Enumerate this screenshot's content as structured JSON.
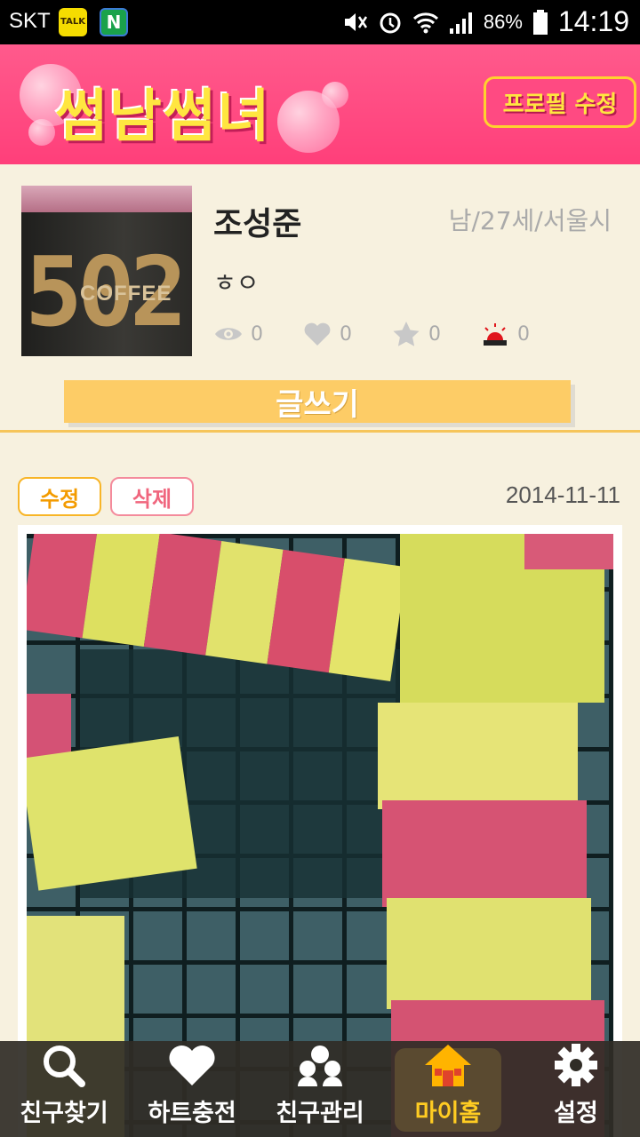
{
  "status_bar": {
    "carrier": "SKT",
    "talk_icon_text": "TALK",
    "n_icon_text": "N",
    "battery": "86%",
    "time": "14:19"
  },
  "header": {
    "logo": "썸남썸녀",
    "edit_profile_label": "프로필 수정"
  },
  "profile": {
    "avatar_number": "502",
    "avatar_brand": "COFFEE",
    "name": "조성준",
    "info": "남/27세/서울시",
    "status_message": "ㅎㅇ",
    "stats": {
      "views": "0",
      "hearts": "0",
      "stars": "0",
      "reports": "0"
    },
    "write_label": "글쓰기"
  },
  "post": {
    "edit_label": "수정",
    "delete_label": "삭제",
    "date": "2014-11-11"
  },
  "nav": [
    {
      "label": "친구찾기",
      "icon": "search-icon"
    },
    {
      "label": "하트충전",
      "icon": "heart-icon"
    },
    {
      "label": "친구관리",
      "icon": "people-icon"
    },
    {
      "label": "마이홈",
      "icon": "home-icon",
      "active": true
    },
    {
      "label": "설정",
      "icon": "gear-icon"
    }
  ]
}
